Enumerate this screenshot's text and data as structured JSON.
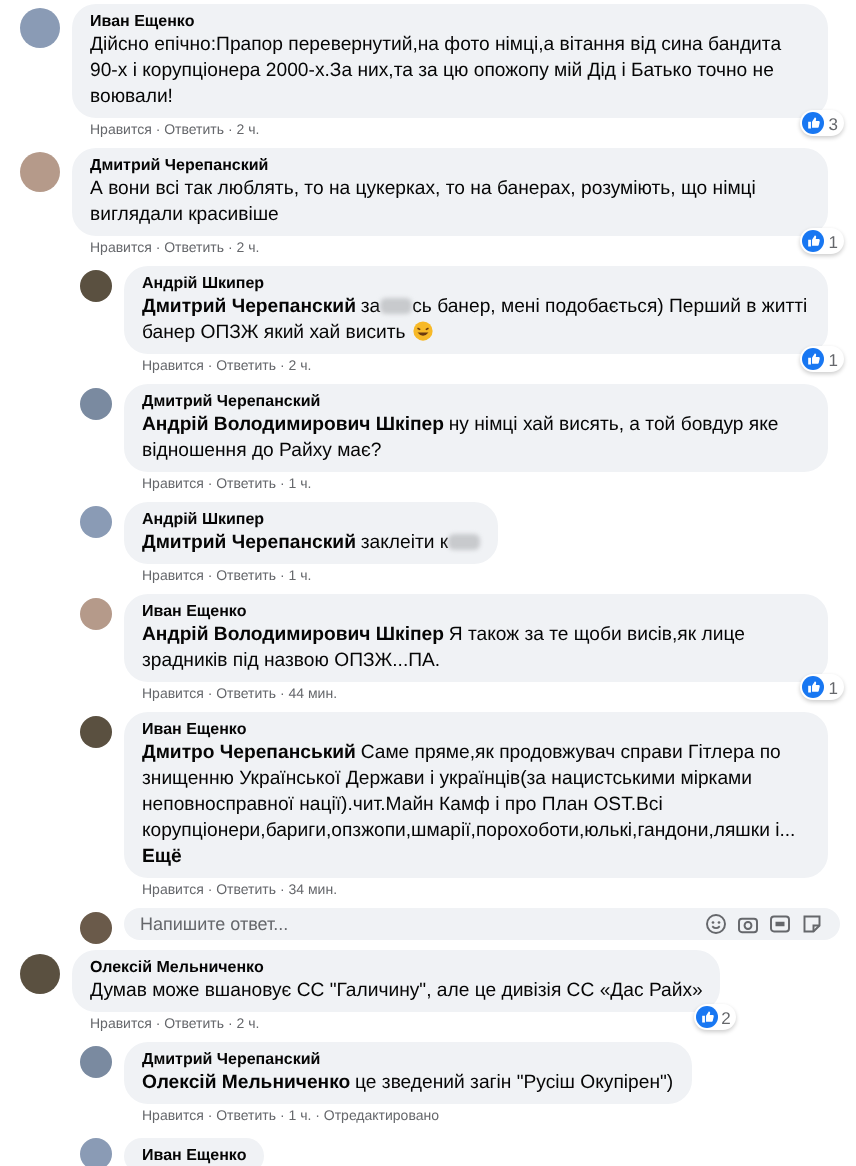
{
  "comments": [
    {
      "author": "Иван Ещенко",
      "segments": [
        {
          "kind": "text",
          "text": "Дійсно епічно:Прапор перевернутий,на фото німці,а вітання від сина бандита 90-х і корупціонера 2000-х.За них,та за цю опожопу мій Дід і Батько точно не воювали!"
        }
      ],
      "meta": "Нравится · Ответить · 2 ч.",
      "reactions": "3"
    },
    {
      "author": "Дмитрий Черепанский",
      "segments": [
        {
          "kind": "text",
          "text": "А вони всі так люблять, то на цукерках, то на банерах, розуміють, що німці виглядали красивіше"
        }
      ],
      "meta": "Нравится · Ответить · 2 ч.",
      "reactions": "1",
      "replies": [
        {
          "author": "Андрій Шкипер",
          "segments": [
            {
              "kind": "mention",
              "text": "Дмитрий Черепанский"
            },
            {
              "kind": "text",
              "text": "за"
            },
            {
              "kind": "censored"
            },
            {
              "kind": "text",
              "text": "сь банер, мені подобається) Перший в житті банер ОПЗЖ який хай висить"
            },
            {
              "kind": "emoji"
            }
          ],
          "meta": "Нравится · Ответить · 2 ч.",
          "reactions": "1"
        },
        {
          "author": "Дмитрий Черепанский",
          "segments": [
            {
              "kind": "mention",
              "text": "Андрій Володимирович Шкіпер"
            },
            {
              "kind": "text",
              "text": "ну німці хай висять, а той бовдур яке відношення до Райху має?"
            }
          ],
          "meta": "Нравится · Ответить · 1 ч."
        },
        {
          "author": "Андрій Шкипер",
          "segments": [
            {
              "kind": "mention",
              "text": "Дмитрий Черепанский"
            },
            {
              "kind": "text",
              "text": "заклеіти к"
            },
            {
              "kind": "censored"
            }
          ],
          "meta": "Нравится · Ответить · 1 ч."
        },
        {
          "author": "Иван Ещенко",
          "segments": [
            {
              "kind": "mention",
              "text": "Андрій Володимирович Шкіпер"
            },
            {
              "kind": "text",
              "text": "Я також за те щоби висів,як лице зрадників під назвою ОПЗЖ...ПА."
            }
          ],
          "meta": "Нравится · Ответить · 44 мин.",
          "reactions": "1"
        },
        {
          "author": "Иван Ещенко",
          "segments": [
            {
              "kind": "mention",
              "text": "Дмитро Черепанський"
            },
            {
              "kind": "text",
              "text": "Саме пряме,як продовжувач справи Гітлера по знищенню Української Держави і українців(за нацистськими мірками неповносправної нації).чит.Майн Камф і про План OST.Всі корупціонери,бариги,опзжопи,шмарії,порохоботи,юлькі,гандони,ляшки і..."
            }
          ],
          "more": "Ещё",
          "meta": "Нравится · Ответить · 34 мин."
        }
      ],
      "reply_box": {
        "placeholder": "Напишите ответ..."
      }
    },
    {
      "author": "Олексій Мельниченко",
      "segments": [
        {
          "kind": "text",
          "text": "Думав може вшановує СС \"Галичину\", але це дивізія СС «Дас Райх»"
        }
      ],
      "meta": "Нравится · Ответить · 2 ч.",
      "reactions": "2",
      "replies": [
        {
          "author": "Дмитрий Черепанский",
          "segments": [
            {
              "kind": "mention",
              "text": "Олексій Мельниченко"
            },
            {
              "kind": "text",
              "text": "це зведений загін \"Русіш Окупірен\")"
            }
          ],
          "meta": "Нравится · Ответить · 1 ч. · Отредактировано"
        },
        {
          "author": "Иван Ещенко"
        }
      ]
    }
  ]
}
